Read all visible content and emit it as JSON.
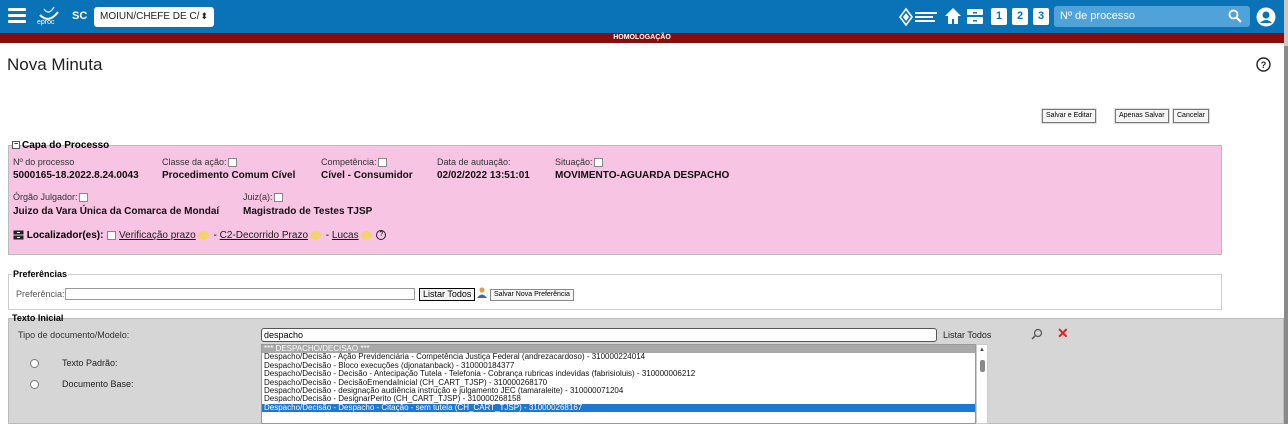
{
  "topbar": {
    "logo_text": "eproc",
    "org": "SC",
    "profile_select": "MOIUN/CHEFE DE C/",
    "quick_buttons": [
      "1",
      "2",
      "3"
    ],
    "process_search_placeholder": "Nº de processo",
    "bg_color": "#0a73b8"
  },
  "banner": {
    "label": "HOMOLOGAÇÃO",
    "color": "#8b0c0c"
  },
  "page": {
    "title": "Nova Minuta"
  },
  "actions": {
    "salvar_editar": "Salvar e Editar",
    "apenas_salvar": "Apenas Salvar",
    "cancelar": "Cancelar"
  },
  "capa": {
    "legend": "Capa do Processo",
    "fields": {
      "numero_label": "Nº do processo",
      "numero": "5000165-18.2022.8.24.0043",
      "classe_label": "Classe da ação:",
      "classe": "Procedimento Comum Cível",
      "competencia_label": "Competência:",
      "competencia": "Cível - Consumidor",
      "data_label": "Data de autuação:",
      "data": "02/02/2022 13:51:01",
      "situacao_label": "Situação:",
      "situacao": "MOVIMENTO-AGUARDA DESPACHO",
      "orgao_label": "Órgão Julgador:",
      "orgao": "Juizo da Vara Única da Comarca de Mondaí",
      "juiz_label": "Juiz(a):",
      "juiz": "Magistrado de Testes TJSP"
    },
    "localizadores_label": "Localizador(es):",
    "localizadores": [
      "Verificação prazo",
      "C2-Decorrido Prazo",
      "Lucas"
    ],
    "bg_color": "#f7c4e3"
  },
  "preferencias": {
    "legend": "Preferências",
    "label": "Preferência:",
    "value": "",
    "listar_todos": "Listar Todos",
    "salvar_nova": "Salvar Nova Preferência"
  },
  "texto_inicial": {
    "legend": "Texto Inicial",
    "tipo_label": "Tipo de documento/Modelo:",
    "tipo_value": "despacho",
    "listar_todos": "Listar Todos",
    "radio_texto_padrao": "Texto Padrão:",
    "radio_documento_base": "Documento Base:",
    "options": [
      "*** DESPACHO/DECISÃO ***",
      "Despacho/Decisão - Ação Previdenciária - Competência Justiça Federal (andrezacardoso) - 310000224014",
      "Despacho/Decisão - Bloco execuções (djonatanback) - 310000184377",
      "Despacho/Decisão - Decisão - Antecipação Tutela - Telefonia - Cobrança rubricas indevidas (fabrisioluis) - 310000006212",
      "Despacho/Decisão - DecisãoEmendaInicial (CH_CART_TJSP) - 310000268170",
      "Despacho/Decisão - designação audiência instrução e julgamento JEC (tamaraleite) - 310000071204",
      "Despacho/Decisão - DesignarPerito (CH_CART_TJSP) - 310000268158",
      "Despacho/Decisão - Despacho - Citação - sem tutela (CH_CART_TJSP) - 310000268167"
    ],
    "selected_index": 7
  }
}
